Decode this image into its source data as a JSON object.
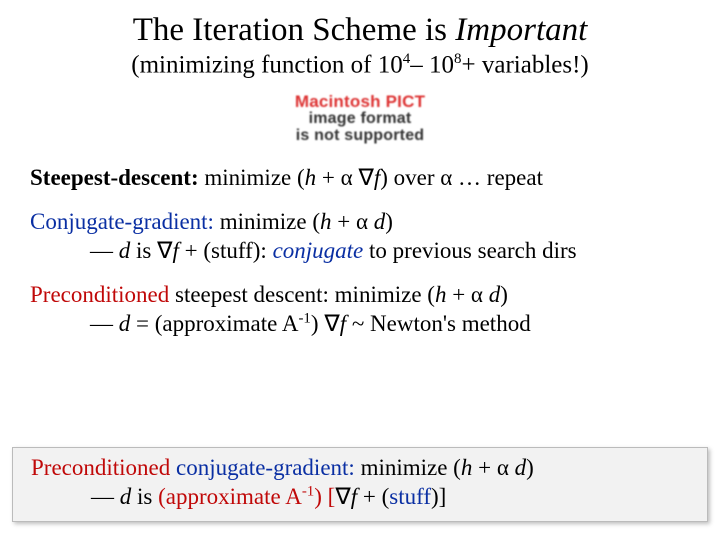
{
  "title": {
    "prefix": "The Iteration Scheme is ",
    "emph": "Important"
  },
  "subtitle": {
    "a": "(minimizing function of 10",
    "exp1": "4",
    "b": "– 10",
    "exp2": "8",
    "c": "+ variables!)"
  },
  "placeholder": {
    "line1": "Macintosh PICT",
    "line2": "image format",
    "line3": "is not supported"
  },
  "steepest": {
    "label": "Steepest-descent:",
    "rest_a": "  minimize (",
    "h": "h",
    "rest_b": " + α ",
    "grad": "∇",
    "f": "f",
    "rest_c": ") over α … repeat"
  },
  "cg": {
    "label": "Conjugate-gradient:",
    "rest_a": "  minimize (",
    "h": "h",
    "rest_b": " + α ",
    "d": "d",
    "rest_c": ")",
    "line2_a": "— ",
    "line2_d": "d",
    "line2_b": " is ",
    "grad": "∇",
    "f": "f",
    "line2_c": " + (stuff): ",
    "conj": "conjugate",
    "line2_d2": " to previous search dirs"
  },
  "psd": {
    "label": "Preconditioned",
    "label2": " steepest descent:  minimize (",
    "h": "h",
    "rest_b": " + α ",
    "d": "d",
    "rest_c": ")",
    "line2_a": "— ",
    "line2_d": "d",
    "line2_b": " = (approximate A",
    "exp": "-1",
    "line2_c": ") ",
    "grad": "∇",
    "f": "f",
    "line2_e": "   ~  Newton's method"
  },
  "pcg": {
    "label": "Preconditioned",
    "label2": " ",
    "label3": "conjugate-gradient:",
    "rest_a": "  minimize (",
    "h": "h",
    "rest_b": " + α ",
    "d": "d",
    "rest_c": ")",
    "line2_a": "— ",
    "line2_d": "d",
    "line2_b": " is ",
    "line2_c": "(approximate A",
    "exp": "-1",
    "line2_e": ") [",
    "grad": "∇",
    "f": "f",
    "line2_f": " + (",
    "stuff": "stuff",
    "line2_g": ")]"
  }
}
